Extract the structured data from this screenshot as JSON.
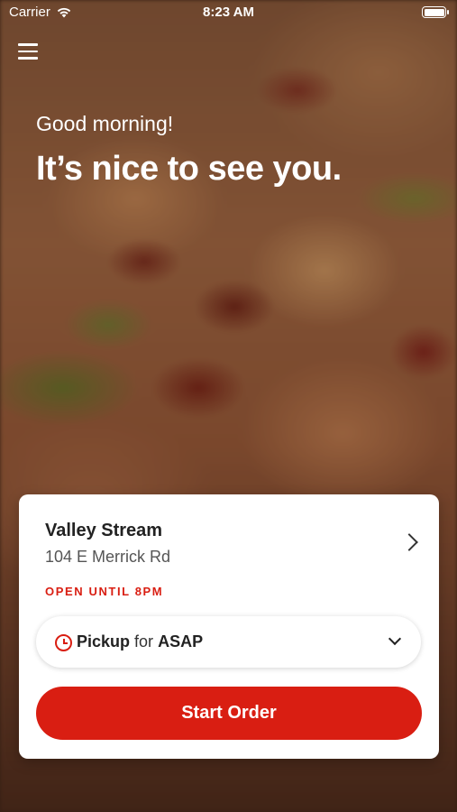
{
  "status_bar": {
    "carrier": "Carrier",
    "time": "8:23 AM",
    "wifi_icon": "wifi-icon",
    "battery_icon": "battery-icon"
  },
  "header": {
    "menu_icon": "hamburger-menu-icon",
    "greeting": "Good morning!",
    "headline": "It’s nice to see you."
  },
  "store": {
    "name": "Valley Stream",
    "address": "104 E Merrick Rd",
    "hours_status": "OPEN UNTIL 8PM"
  },
  "order_mode": {
    "icon": "clock-icon",
    "mode": "Pickup",
    "connector": "for",
    "time": "ASAP"
  },
  "cta": {
    "start_order_label": "Start Order"
  },
  "colors": {
    "accent": "#d91e12",
    "card_bg": "#ffffff",
    "text_primary": "#222222"
  }
}
